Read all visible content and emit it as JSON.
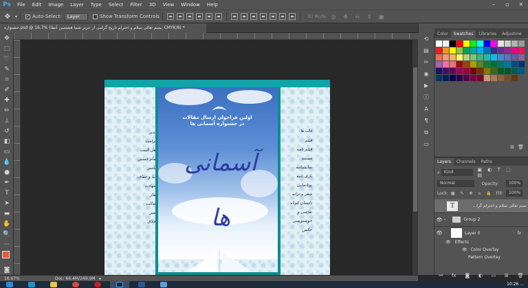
{
  "app": {
    "logo": "Ps"
  },
  "menu": [
    "File",
    "Edit",
    "Image",
    "Layer",
    "Type",
    "Select",
    "Filter",
    "3D",
    "View",
    "Window",
    "Help"
  ],
  "options": {
    "auto_select_label": "Auto-Select:",
    "auto_select_value": "Layer",
    "transform_label": "Show Transform Controls",
    "mode_label": "3D Mode:"
  },
  "document": {
    "tab_title": "جشنواره.psd @ 16.7% (بسم تعالی سلام و احترام تاریخ گرامی از عزیز شما هشتمین آنطا, CMYK/8) *",
    "artwork": {
      "headline_line1": "اولین فراخوان ارسال مقالات",
      "headline_line2": "در جشنواره آسمانی ها",
      "calligraphy": "آسمانی ها",
      "right_head": "قالب ها :",
      "right_list": [
        "فیلم",
        "فیلم نامه",
        "مستند",
        "نمایشنامه",
        "بازی نامه",
        "پویانمایی",
        "شعر و ترانه",
        "داستان کوتاه",
        "نقاشی و خوشنویسی",
        "عکس"
      ],
      "left_list": [
        "غدیر",
        "کرامت",
        "اهل البیت",
        "امام حسین",
        "پیامبر",
        "حیا و عفاف",
        "شهادت",
        "نماز",
        "عدالت",
        "صبر",
        "اخلاق"
      ]
    }
  },
  "status": {
    "zoom": "16.67%",
    "doc": "Doc: 66.4M/249.9M"
  },
  "panels": {
    "swatch_tabs": [
      "Color",
      "Swatches",
      "Libraries",
      "Adjustme"
    ],
    "swatch_active": "Swatches",
    "layers_tabs": [
      "Layers",
      "Channels",
      "Paths"
    ],
    "layers_active": "Layers",
    "filter_kind": "Kind",
    "blend_mode": "Normal",
    "opacity_label": "Opacity:",
    "opacity_value": "100%",
    "lock_label": "Lock:",
    "fill_label": "Fill:",
    "fill_value": "100%",
    "layers": [
      {
        "name": "بسم تعالی سلام و احترام گرا...",
        "type": "text"
      },
      {
        "name": "Group 2",
        "type": "group"
      },
      {
        "name": "Layer 0",
        "type": "pixel",
        "fx": "fx"
      }
    ],
    "effects_label": "Effects",
    "effects": [
      "Color Overlay",
      "Pattern Overlay"
    ]
  },
  "taskbar": {
    "time": "10:26 ..."
  },
  "colors": {
    "swatches": [
      "#ffffff",
      "#f0f0f0",
      "#000000",
      "#ff0000",
      "#ffff00",
      "#00ff00",
      "#00ffff",
      "#0000ff",
      "#ff00ff",
      "#e6e6e6",
      "#cccccc",
      "#b3b3b3",
      "#999999",
      "#ed1c24",
      "#f7941d",
      "#fff200",
      "#8dc63f",
      "#00a651",
      "#00a99d",
      "#00aeef",
      "#0072bc",
      "#2e3192",
      "#662d91",
      "#92278f",
      "#ec008c",
      "#ed145b",
      "#f26c4f",
      "#f69679",
      "#fbaf5d",
      "#fff568",
      "#acd373",
      "#7cc576",
      "#3bb878",
      "#1abbb4",
      "#00bff3",
      "#438cca",
      "#5574b9",
      "#605ca8",
      "#855fa8",
      "#a763a8",
      "#f06ea9",
      "#f26d7d",
      "#9e0b0f",
      "#a0410d",
      "#aba000",
      "#598527",
      "#197b30",
      "#007236",
      "#00746b",
      "#0076a3",
      "#004a80",
      "#003471",
      "#1b1464",
      "#440e62",
      "#630460",
      "#9e005d",
      "#9e0039",
      "#790000",
      "#7b2e00",
      "#827b00",
      "#406618",
      "#005e20",
      "#005826",
      "#005952",
      "#005b7f",
      "#003663",
      "#002157",
      "#0d004c",
      "#32004b",
      "#4b0049",
      "#7b0046",
      "#7a0026",
      "#c69c6d",
      "#a67c52",
      "#8c6239",
      "#754c24",
      "#603913"
    ]
  }
}
